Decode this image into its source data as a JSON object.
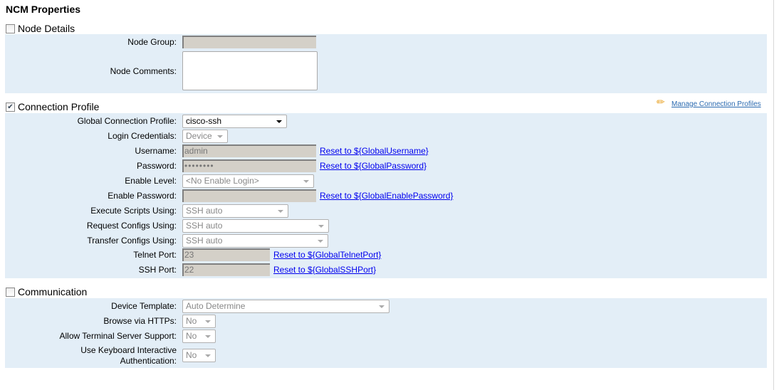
{
  "title": "NCM Properties",
  "node_details": {
    "label": "Node Details",
    "checked": false,
    "node_group_label": "Node Group:",
    "node_group": "",
    "node_comments_label": "Node Comments:",
    "node_comments": ""
  },
  "connection": {
    "label": "Connection Profile",
    "checked": true,
    "manage_link": "Manage Connection Profiles",
    "global_profile_label": "Global Connection Profile:",
    "global_profile": "cisco-ssh",
    "login_cred_label": "Login Credentials:",
    "login_cred": "Device",
    "username_label": "Username:",
    "username": "admin",
    "username_reset": "Reset to ${GlobalUsername}",
    "password_label": "Password:",
    "password": "••••••••",
    "password_reset": "Reset to ${GlobalPassword}",
    "enable_level_label": "Enable Level:",
    "enable_level": "<No Enable Login>",
    "enable_password_label": "Enable Password:",
    "enable_password": "",
    "enable_password_reset": "Reset to ${GlobalEnablePassword}",
    "exec_label": "Execute Scripts Using:",
    "exec": "SSH auto",
    "request_label": "Request Configs Using:",
    "request": "SSH auto",
    "transfer_label": "Transfer Configs Using:",
    "transfer": "SSH auto",
    "telnet_label": "Telnet Port:",
    "telnet": "23",
    "telnet_reset": "Reset to ${GlobalTelnetPort}",
    "ssh_label": "SSH Port:",
    "ssh": "22",
    "ssh_reset": "Reset to ${GlobalSSHPort}"
  },
  "communication": {
    "label": "Communication",
    "checked": false,
    "template_label": "Device Template:",
    "template": "Auto Determine",
    "https_label": "Browse via HTTPs:",
    "https": "No",
    "terminal_label": "Allow Terminal Server Support:",
    "terminal": "No",
    "keyboard_label_1": "Use Keyboard Interactive",
    "keyboard_label_2": "Authentication:",
    "keyboard": "No"
  }
}
